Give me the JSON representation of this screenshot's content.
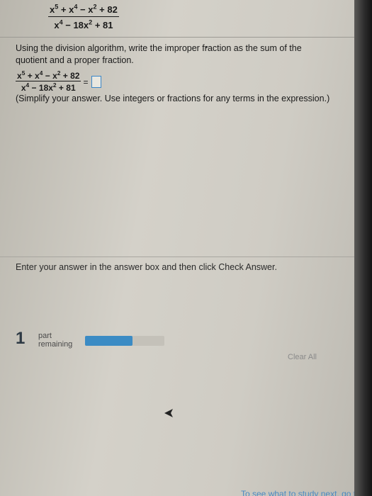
{
  "expression": {
    "numerator": {
      "t1": "x",
      "t1_exp": "5",
      "op1": " + ",
      "t2": "x",
      "t2_exp": "4",
      "op2": " − ",
      "t3": "x",
      "t3_exp": "2",
      "op3": " + 82"
    },
    "denominator": {
      "t1": "x",
      "t1_exp": "4",
      "op1": " − 18x",
      "t2_exp": "2",
      "op2": " + 81"
    }
  },
  "instructions": "Using the division algorithm, write the improper fraction as the sum of the quotient and a proper fraction.",
  "equation": {
    "equals": "=",
    "answer_value": ""
  },
  "hint": "(Simplify your answer. Use integers or fractions for any terms in the expression.)",
  "enter_message": "Enter your answer in the answer box and then click Check Answer.",
  "parts": {
    "count": "1",
    "label_line1": "part",
    "label_line2": "remaining",
    "progress_fraction": 0.6
  },
  "clear_all_label": "Clear All",
  "bottom_link": "To see what to study next, go to your Study Plan",
  "colors": {
    "accent": "#3b8bc4",
    "answer_box_border": "#3a86c8",
    "link": "#4b89c2"
  }
}
